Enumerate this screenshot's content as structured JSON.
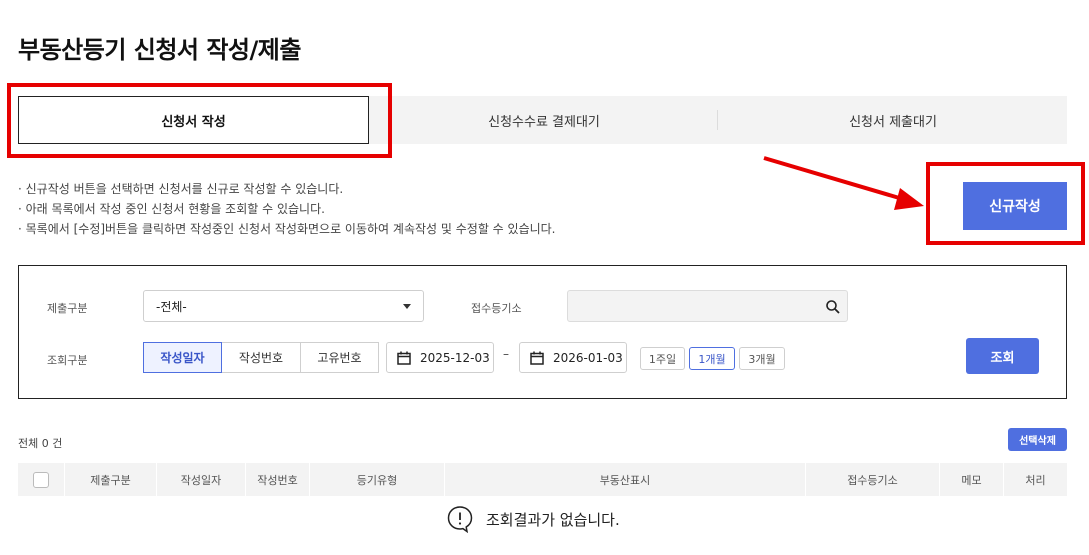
{
  "page_title": "부동산등기 신청서 작성/제출",
  "tabs": [
    {
      "label": "신청서 작성",
      "active": true
    },
    {
      "label": "신청수수료 결제대기",
      "active": false
    },
    {
      "label": "신청서 제출대기",
      "active": false
    }
  ],
  "notes": [
    "신규작성 버튼을 선택하면 신청서를 신규로 작성할 수 있습니다.",
    "아래 목록에서 작성 중인 신청서 현황을 조회할 수 있습니다.",
    "목록에서 [수정]버튼을 클릭하면 작성중인 신청서 작성화면으로 이동하여 계속작성 및 수정할 수 있습니다."
  ],
  "new_button_label": "신규작성",
  "search": {
    "submit_type_label": "제출구분",
    "submit_type_value": "-전체-",
    "office_label": "접수등기소",
    "office_value": "",
    "query_type_label": "조회구분",
    "query_types": [
      {
        "label": "작성일자",
        "active": true
      },
      {
        "label": "작성번호",
        "active": false
      },
      {
        "label": "고유번호",
        "active": false
      }
    ],
    "date_from": "2025-12-03",
    "date_separator": "–",
    "date_to": "2026-01-03",
    "periods": [
      {
        "label": "1주일",
        "active": false
      },
      {
        "label": "1개월",
        "active": true
      },
      {
        "label": "3개월",
        "active": false
      }
    ],
    "query_button": "조회"
  },
  "result": {
    "total_text": "전체 0 건",
    "delete_button": "선택삭제",
    "columns": [
      "제출구분",
      "작성일자",
      "작성번호",
      "등기유형",
      "부동산표시",
      "접수등기소",
      "메모",
      "처리"
    ],
    "empty_text": "조회결과가 없습니다."
  },
  "colors": {
    "accent": "#4f6fe0",
    "annotation": "#e60000"
  }
}
